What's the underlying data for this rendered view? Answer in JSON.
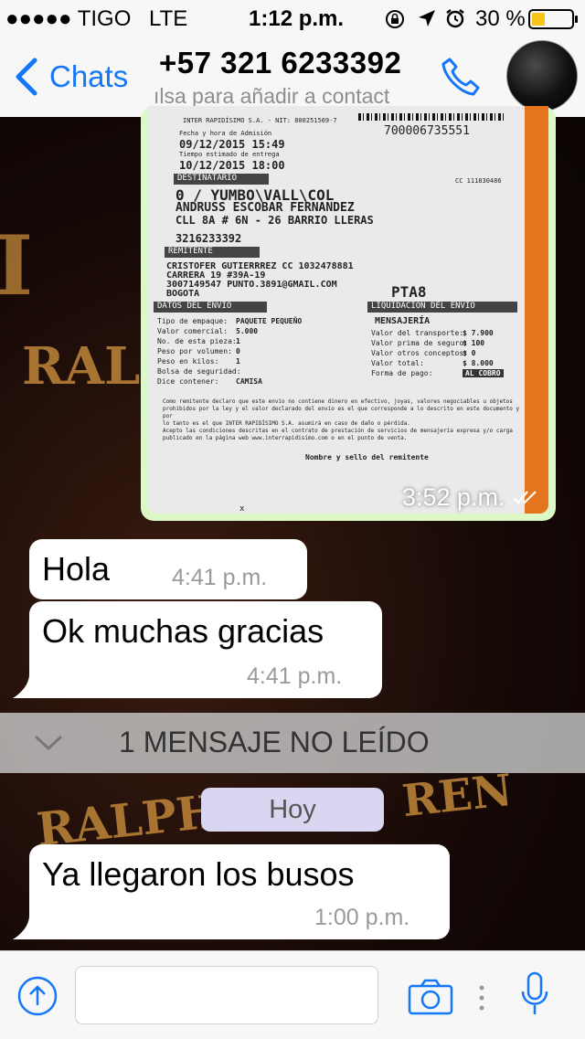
{
  "status_bar": {
    "carrier": "●●●●● TIGO",
    "network": "LTE",
    "time": "1:12 p.m.",
    "battery_percent": "30 %"
  },
  "header": {
    "back_label": "Chats",
    "title": "+57 321 6233392",
    "subtitle": "ılsa para añadir a contact"
  },
  "background_text": {
    "left": "RAL",
    "bottom_left": "RALPH",
    "right": "REN"
  },
  "image_message": {
    "time": "3:52 p.m.",
    "receipt": {
      "company": "INTER RAPIDÍSIMO S.A. - NIT: 800251569-7",
      "barcode_number": "700006735551",
      "admission_label": "Fecha y hora de Admisión",
      "admission_value": "09/12/2015 15:49",
      "delivery_label": "Tiempo estimado de entrega",
      "delivery_value": "10/12/2015 18:00",
      "recipient_header": "DESTINATARIO",
      "cc": "CC 111830486",
      "recipient_city": "0 / YUMBO\\VALL\\COL",
      "recipient_name": "ANDRUSS ESCOBAR FERNANDEZ",
      "recipient_address": "CLL 8A # 6N - 26 BARRIO LLERAS",
      "recipient_phone": "3216233392",
      "sender_header": "REMITENTE",
      "sender_name": "CRISTOFER GUTIERRREZ  CC 1032478881",
      "sender_address": "CARRERA 19 #39A-19",
      "sender_phone": "3007149547   PUNTO.3891@GMAIL.COM",
      "sender_city": "BOGOTA",
      "pta": "PTA8",
      "shipping_header": "DATOS DEL ENVIO",
      "billing_header": "LIQUIDACIÓN DEL ENVIO",
      "rows_left": [
        [
          "Tipo de empaque:",
          "PAQUETE PEQUEÑO"
        ],
        [
          "Valor comercial:",
          "5.000"
        ],
        [
          "No. de esta pieza:",
          "1"
        ],
        [
          "Peso por volumen:",
          "0"
        ],
        [
          "Peso en kilos:",
          "1"
        ],
        [
          "Bolsa de seguridad:",
          ""
        ],
        [
          "Dice contener:",
          "CAMISA"
        ]
      ],
      "service": "MENSAJERÍA",
      "rows_right": [
        [
          "Valor del transporte:",
          "$ 7.900"
        ],
        [
          "Valor prima de seguro:",
          "$ 100"
        ],
        [
          "Valor otros conceptos:",
          "$ 0"
        ],
        [
          "Valor total:",
          "$ 8.000"
        ],
        [
          "Forma de pago:",
          "AL COBRO"
        ]
      ],
      "disclaimer_1": "Como remitente declaro que este envío no contiene dinero en efectivo, joyas, valores negociables u objetos",
      "disclaimer_2": "prohibidos por la ley y el valor declarado del envío es el que corresponde a lo descrito en este documento y por",
      "disclaimer_3": "lo tanto es el que INTER RAPIDÍSIMO S.A. asumirá en caso de daño o pérdida.",
      "disclaimer_4": "Acepto las condiciones descritas en el contrato de prestación de servicios de mensajería expresa y/o carga",
      "disclaimer_5": "publicado en la página web www.interrapidisimo.com o en el punto de venta.",
      "signature_label": "Nombre y sello del remitente",
      "mark": "x"
    }
  },
  "messages": [
    {
      "text": "Hola",
      "time": "4:41 p.m."
    },
    {
      "text": "Ok muchas gracias",
      "time": "4:41 p.m."
    },
    {
      "text": "Ya llegaron los busos",
      "time": "1:00 p.m."
    }
  ],
  "unread_banner": "1 MENSAJE NO LEÍDO",
  "day_label": "Hoy",
  "colors": {
    "accent": "#1477f8",
    "outgoing_bubble": "#dcf8c6",
    "incoming_bubble": "#ffffff",
    "day_badge": "#d9d6f1"
  },
  "icons": [
    "back-chevron-icon",
    "phone-icon",
    "upload-icon",
    "camera-icon",
    "more-dots-icon",
    "microphone-icon",
    "lock-rotation-icon",
    "location-arrow-icon",
    "alarm-icon",
    "battery-icon",
    "double-check-icon"
  ]
}
